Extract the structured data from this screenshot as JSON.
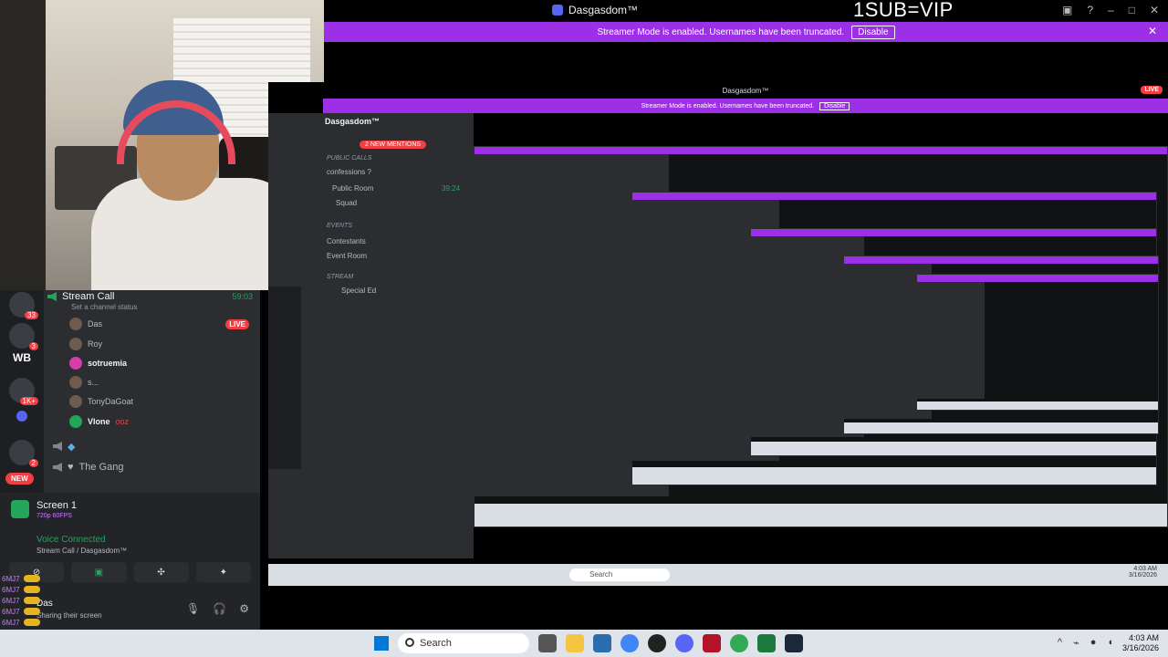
{
  "window": {
    "title": "Dasgasdom™",
    "overlay_text": "1SUB=VIP"
  },
  "banner": {
    "text": "Streamer Mode is enabled. Usernames have been truncated.",
    "button": "Disable"
  },
  "sidebar": {
    "channel": {
      "name": "Stream Call",
      "time": "59:03",
      "status": "Set a channel status"
    },
    "users": [
      {
        "name": "Das",
        "live": "LIVE"
      },
      {
        "name": "Roy"
      },
      {
        "name": "sotruemia"
      },
      {
        "name": "s..."
      },
      {
        "name": "TonyDaGoat"
      },
      {
        "name": "Vlone",
        "extra": "ooz"
      }
    ],
    "other_channel": "The Gang",
    "new_pill": "NEW",
    "wb": "WB",
    "badges": [
      "33",
      "3",
      "1K+",
      "2"
    ]
  },
  "stream_card": {
    "title": "Screen 1",
    "sub": "720p 60FPS"
  },
  "voice": {
    "status": "Voice Connected",
    "location": "Stream Call / Dasgasdom™"
  },
  "user_panel": {
    "name": "Das",
    "status": "Sharing their screen"
  },
  "chat_overlay": [
    {
      "name": "6MJ7"
    },
    {
      "name": "6MJ7"
    },
    {
      "name": "6MJ7"
    },
    {
      "name": "6MJ7"
    },
    {
      "name": "6MJ7"
    }
  ],
  "capture": {
    "server_name": "Dasgasdom™",
    "mentions": "2 NEW MENTIONS",
    "rows": [
      {
        "label": "PUBLIC CALLS",
        "kind": "cat"
      },
      {
        "label": "confessions ?",
        "kind": "ch"
      },
      {
        "label": "Public Room",
        "kind": "ch",
        "time": "39:24"
      },
      {
        "label": "Squad",
        "kind": "ch"
      },
      {
        "label": "Events",
        "kind": "cat"
      },
      {
        "label": "Contestants",
        "kind": "ch"
      },
      {
        "label": "Event Room",
        "kind": "ch"
      },
      {
        "label": "STREAM",
        "kind": "cat"
      },
      {
        "label": "Special Ed",
        "kind": "ch"
      }
    ],
    "live": "LIVE"
  },
  "taskbar": {
    "search_placeholder": "Search",
    "time": "4:03 AM",
    "date": "3/16/2026"
  }
}
